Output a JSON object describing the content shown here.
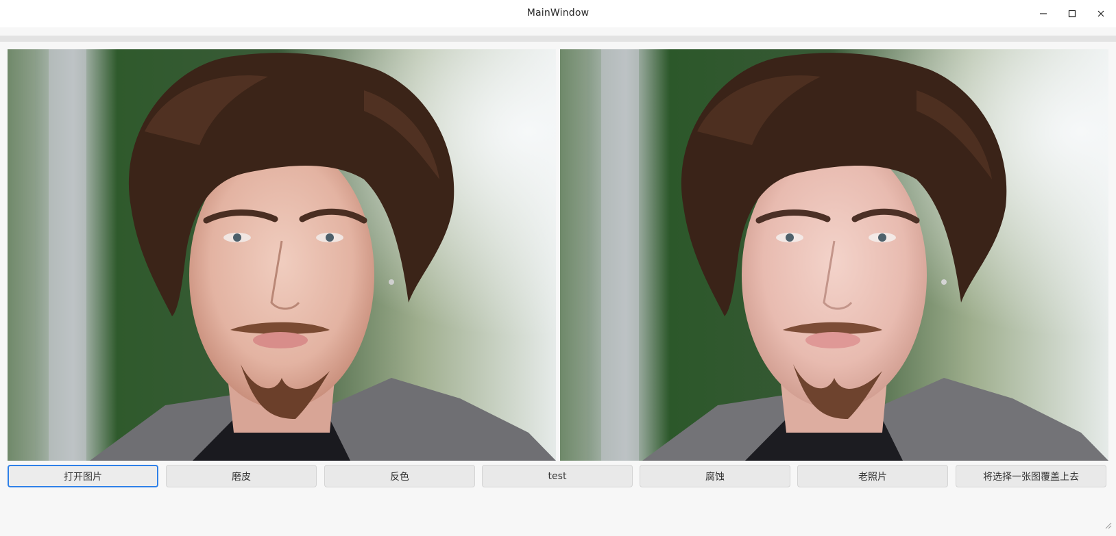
{
  "window": {
    "title": "MainWindow",
    "controls": [
      "minimize-icon",
      "maximize-icon",
      "close-icon"
    ]
  },
  "images": {
    "left": {
      "description_name": "original-photo"
    },
    "right": {
      "description_name": "processed-photo"
    }
  },
  "buttons": [
    {
      "label": "打开图片",
      "focused": true
    },
    {
      "label": "磨皮",
      "focused": false
    },
    {
      "label": "反色",
      "focused": false
    },
    {
      "label": "test",
      "focused": false
    },
    {
      "label": "腐蚀",
      "focused": false
    },
    {
      "label": "老照片",
      "focused": false
    },
    {
      "label": "将选择一张图覆盖上去",
      "focused": false
    }
  ],
  "colors": {
    "focus_border": "#2e80e8",
    "button_bg": "#e9e9e9",
    "window_bg": "#f7f7f7"
  }
}
